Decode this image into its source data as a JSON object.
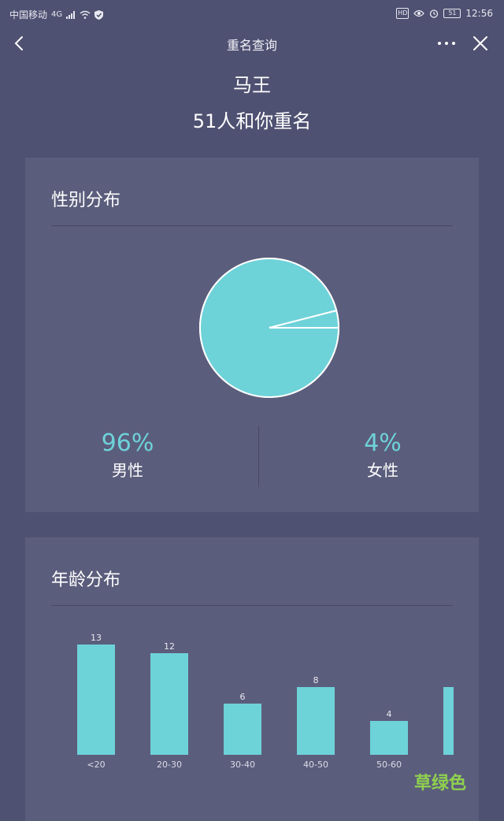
{
  "status_bar": {
    "carrier": "中国移动",
    "network": "4G",
    "hd_badge": "HD",
    "battery": "51",
    "time": "12:56",
    "icons": [
      "signal-icon",
      "wifi-icon",
      "shield-check-icon",
      "eye-icon",
      "alarm-icon",
      "battery-icon"
    ]
  },
  "nav": {
    "title": "重名查询",
    "icons": [
      "back-arrow-icon",
      "more-dots-icon",
      "close-icon"
    ]
  },
  "header": {
    "name": "马王",
    "count_text": "51人和你重名"
  },
  "gender_card": {
    "title": "性别分布",
    "male": {
      "value": "96%",
      "label": "男性",
      "share": 96
    },
    "female": {
      "value": "4%",
      "label": "女性",
      "share": 4
    }
  },
  "age_card": {
    "title": "年龄分布",
    "chart_data": {
      "type": "bar",
      "categories": [
        "<20",
        "20-30",
        "30-40",
        "40-50",
        "50-60",
        ""
      ],
      "values": [
        13,
        12,
        6,
        8,
        4,
        8
      ],
      "title": "年龄分布",
      "ylim": [
        0,
        13
      ]
    }
  },
  "colors": {
    "background": "#4f5172",
    "card": "#5b5d7c",
    "accent": "#6ed2d9",
    "watermark": "#8fd14f"
  },
  "watermark": "草绿色"
}
